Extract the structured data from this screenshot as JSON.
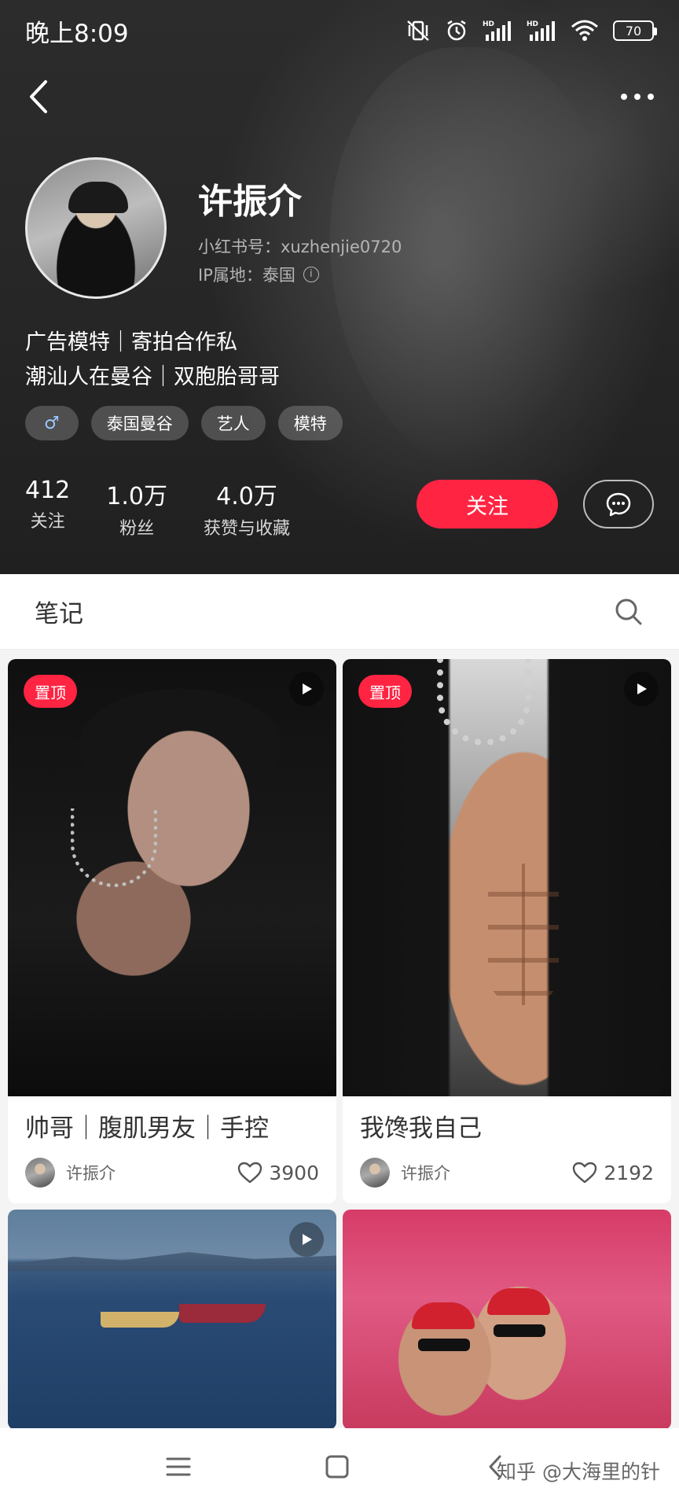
{
  "status_bar": {
    "time": "晚上8:09",
    "battery": "70",
    "icons": [
      "mute-vibrate-icon",
      "alarm-icon",
      "hd-signal-icon",
      "hd-signal-icon",
      "wifi-icon",
      "battery-icon"
    ]
  },
  "header": {
    "back_icon": "chevron-left-icon",
    "more_icon": "more-horizontal-icon"
  },
  "profile": {
    "name": "许振介",
    "red_id": "小红书号：xuzhenjie0720",
    "ip_location": "IP属地：泰国",
    "bio_line1": "广告模特｜寄拍合作私",
    "bio_line2": "潮汕人在曼谷｜双胞胎哥哥",
    "gender_symbol": "♂",
    "tags": [
      "泰国曼谷",
      "艺人",
      "模特"
    ],
    "stats": [
      {
        "value": "412",
        "label": "关注"
      },
      {
        "value": "1.0万",
        "label": "粉丝"
      },
      {
        "value": "4.0万",
        "label": "获赞与收藏"
      }
    ],
    "follow_label": "关注"
  },
  "notes_section": {
    "title": "笔记"
  },
  "notes": [
    {
      "title": "帅哥｜腹肌男友｜手控",
      "author": "许振介",
      "likes": "3900",
      "pinned_label": "置顶",
      "is_video": true
    },
    {
      "title": "我馋我自己",
      "author": "许振介",
      "likes": "2192",
      "pinned_label": "置顶",
      "is_video": true
    },
    {
      "is_video": true
    },
    {
      "is_video": false
    }
  ],
  "watermark": "知乎 @大海里的针",
  "colors": {
    "accent": "#ff2442",
    "header_bg": "#262626"
  }
}
